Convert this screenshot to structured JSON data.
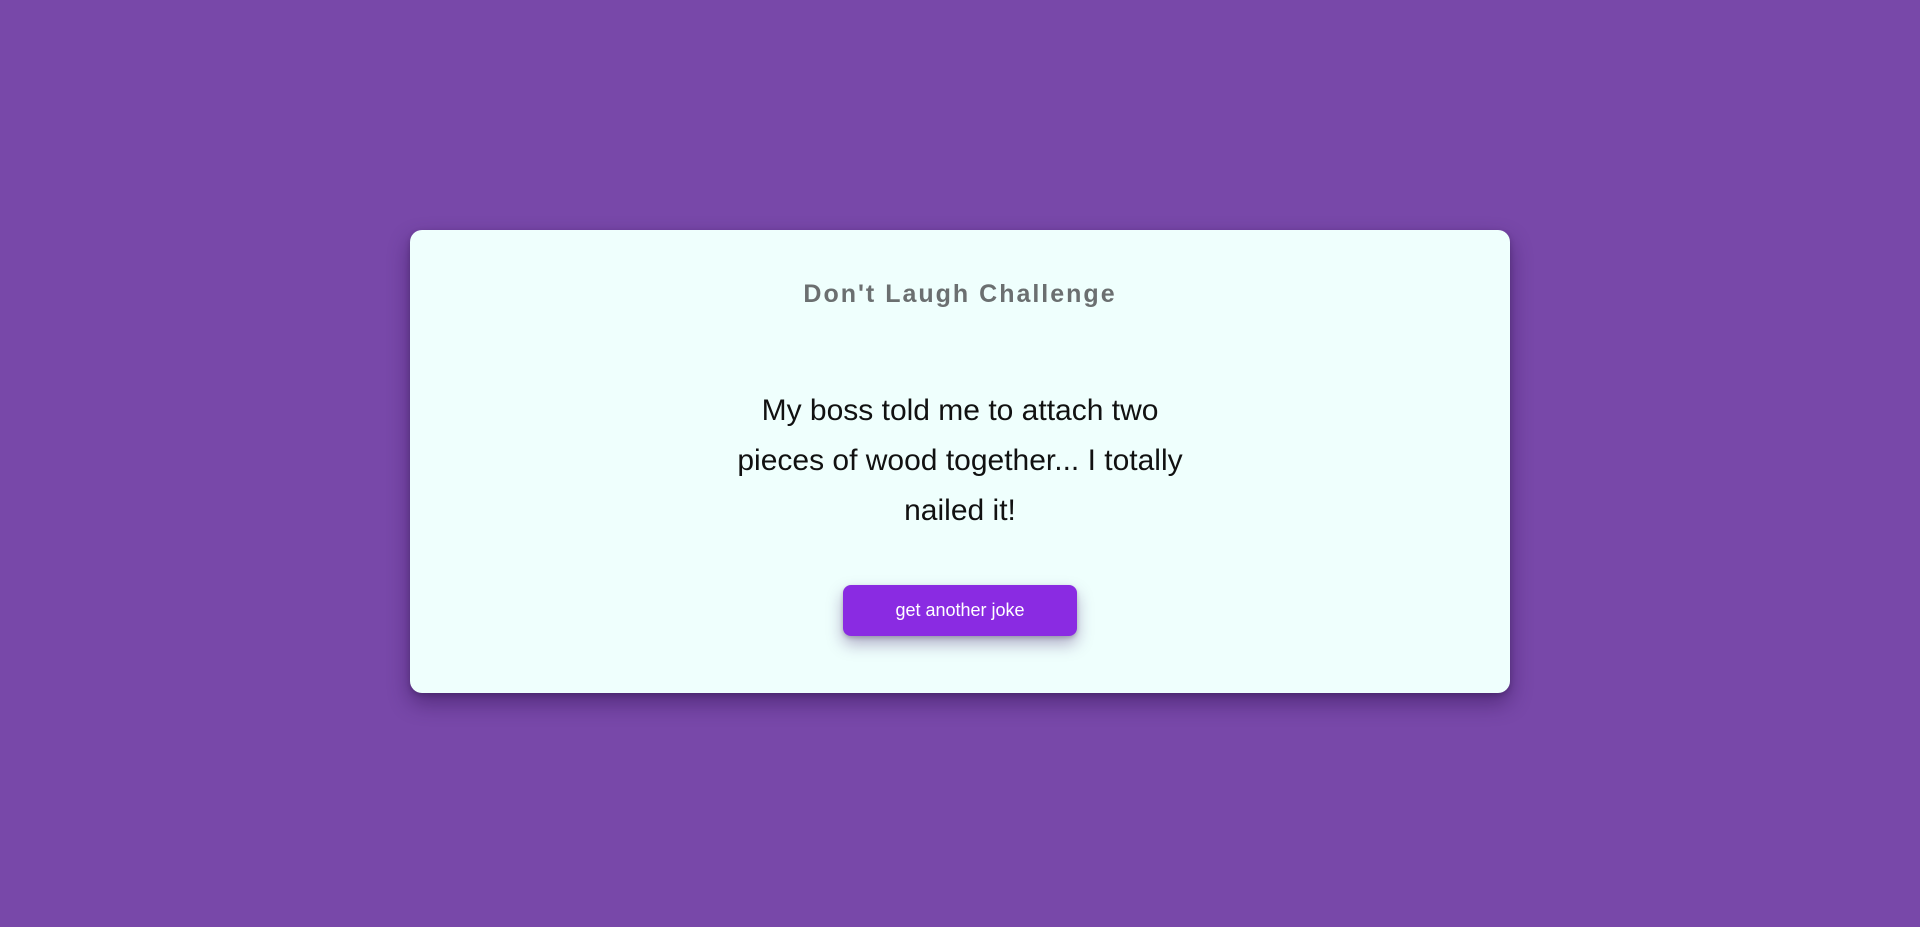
{
  "colors": {
    "background": "#7848a9",
    "card": "#effffd",
    "button": "#8a2be2",
    "title": "#6b6f70"
  },
  "card": {
    "title": "Don't Laugh Challenge",
    "joke": "My boss told me to attach two pieces of wood together... I totally nailed it!",
    "button_label": "get another joke"
  }
}
